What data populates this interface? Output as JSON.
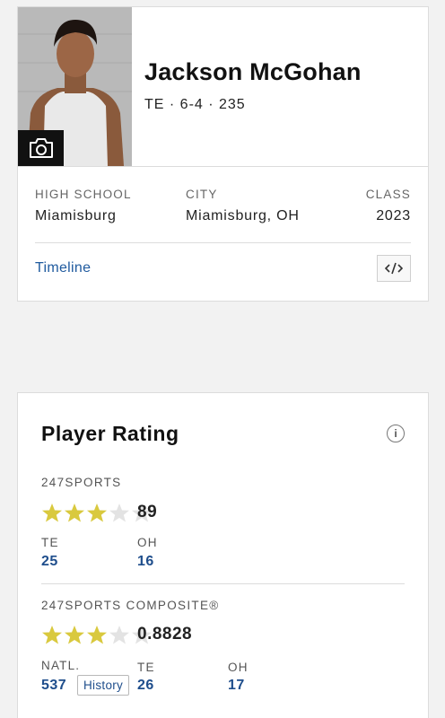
{
  "profile": {
    "name": "Jackson McGohan",
    "position_line": "TE · 6-4 · 235",
    "high_school_label": "HIGH SCHOOL",
    "high_school": "Miamisburg",
    "city_label": "CITY",
    "city": "Miamisburg, OH",
    "class_label": "CLASS",
    "class_year": "2023",
    "timeline_link": "Timeline",
    "photo_icon": "camera-icon",
    "embed_icon": "code-embed-icon"
  },
  "rating": {
    "title": "Player Rating",
    "info_icon": "i",
    "sports247": {
      "label": "247SPORTS",
      "stars": 3,
      "max_stars": 5,
      "score": "89",
      "ranks": [
        {
          "label": "TE",
          "value": "25"
        },
        {
          "label": "OH",
          "value": "16"
        }
      ]
    },
    "composite": {
      "label": "247SPORTS COMPOSITE®",
      "stars": 3,
      "max_stars": 5,
      "score": "0.8828",
      "ranks": [
        {
          "label": "NATL.",
          "value": "537"
        },
        {
          "label": "TE",
          "value": "26"
        },
        {
          "label": "OH",
          "value": "17"
        }
      ],
      "history_button": "History"
    }
  },
  "colors": {
    "star_filled": "#d9c93e",
    "star_empty": "#e3e3e3",
    "link_blue": "#1f5a9e",
    "rank_blue": "#1f4e8c"
  }
}
